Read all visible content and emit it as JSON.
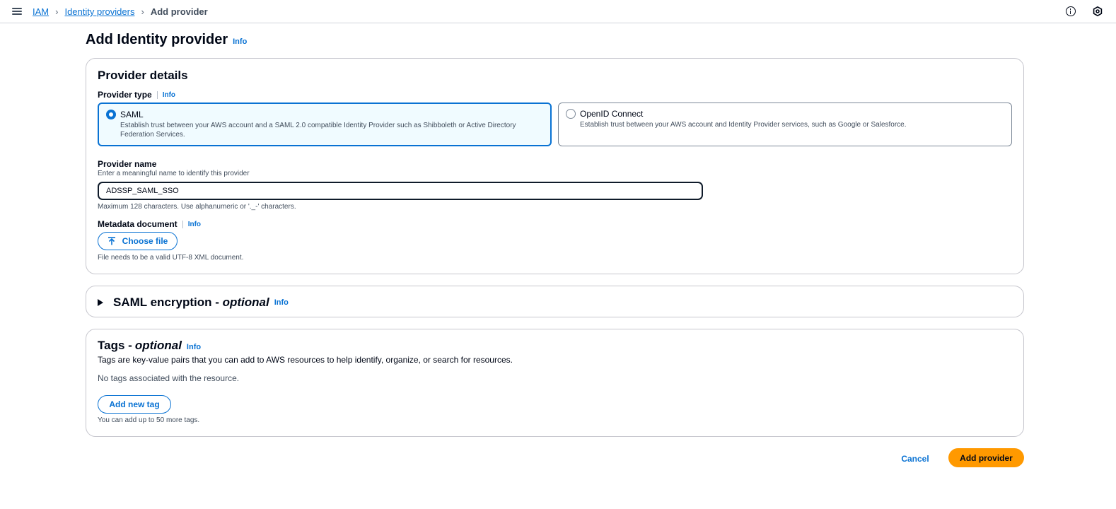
{
  "breadcrumb": {
    "root": "IAM",
    "parent": "Identity providers",
    "current": "Add provider"
  },
  "page": {
    "title": "Add Identity provider",
    "info": "Info"
  },
  "provider_details": {
    "title": "Provider details",
    "type_label": "Provider type",
    "type_info": "Info",
    "options": [
      {
        "title": "SAML",
        "description": "Establish trust between your AWS account and a SAML 2.0 compatible Identity Provider such as Shibboleth or Active Directory Federation Services.",
        "selected": true
      },
      {
        "title": "OpenID Connect",
        "description": "Establish trust between your AWS account and Identity Provider services, such as Google or Salesforce.",
        "selected": false
      }
    ],
    "name_label": "Provider name",
    "name_description": "Enter a meaningful name to identify this provider",
    "name_value": "ADSSP_SAML_SSO",
    "name_constraint": "Maximum 128 characters. Use alphanumeric or '._-' characters.",
    "metadata_label": "Metadata document",
    "metadata_info": "Info",
    "choose_file": "Choose file",
    "metadata_constraint": "File needs to be a valid UTF-8 XML document."
  },
  "saml_encryption": {
    "title": "SAML encryption - ",
    "optional": "optional",
    "info": "Info"
  },
  "tags": {
    "title": "Tags - ",
    "optional": "optional",
    "info": "Info",
    "description": "Tags are key-value pairs that you can add to AWS resources to help identify, organize, or search for resources.",
    "empty": "No tags associated with the resource.",
    "add_button": "Add new tag",
    "limit": "You can add up to 50 more tags."
  },
  "actions": {
    "cancel": "Cancel",
    "submit": "Add provider"
  },
  "colors": {
    "link": "#0972d3",
    "primary_button": "#ff9900",
    "selected_tile_bg": "#f0fbff",
    "text": "#000716"
  },
  "icons": {
    "menu": "hamburger-menu-icon",
    "breadcrumb_separator": "chevron-right-icon",
    "help": "info-circle-icon",
    "settings": "settings-hexagon-icon",
    "upload": "upload-arrow-icon",
    "expand": "caret-right-icon"
  }
}
